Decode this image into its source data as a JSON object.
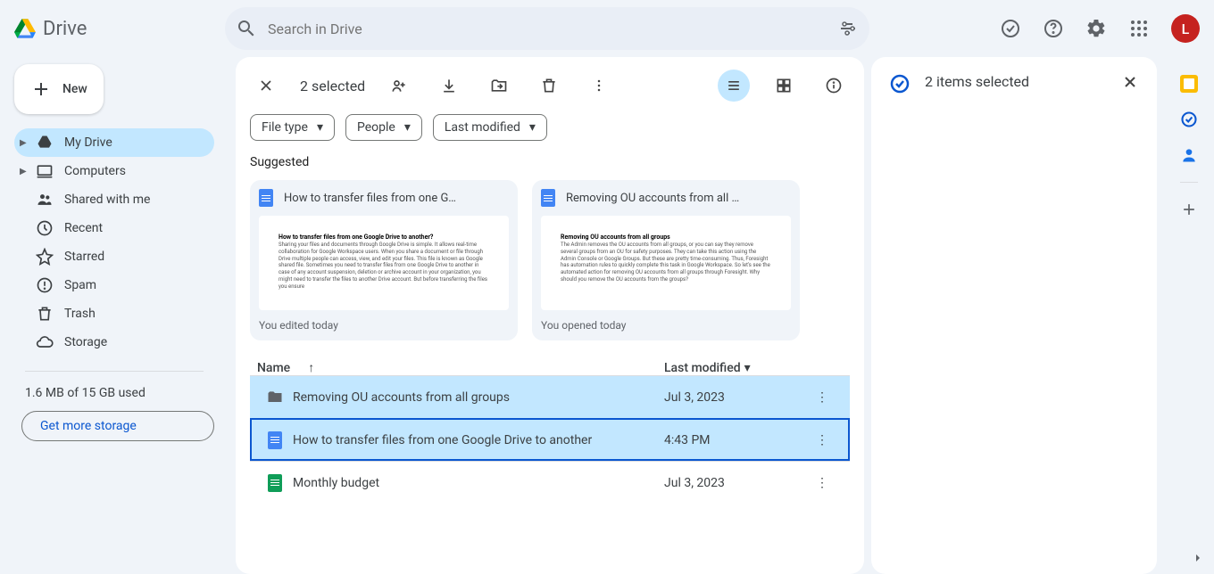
{
  "app": {
    "name": "Drive",
    "avatar_letter": "L"
  },
  "search": {
    "placeholder": "Search in Drive"
  },
  "sidebar": {
    "new_label": "New",
    "items": [
      {
        "label": "My Drive",
        "icon": "drive"
      },
      {
        "label": "Computers",
        "icon": "computer"
      },
      {
        "label": "Shared with me",
        "icon": "shared"
      },
      {
        "label": "Recent",
        "icon": "recent"
      },
      {
        "label": "Starred",
        "icon": "star"
      },
      {
        "label": "Spam",
        "icon": "spam"
      },
      {
        "label": "Trash",
        "icon": "trash"
      },
      {
        "label": "Storage",
        "icon": "storage"
      }
    ],
    "storage_used": "1.6 MB of 15 GB used",
    "storage_cta": "Get more storage"
  },
  "selection_bar": {
    "count_label": "2 selected"
  },
  "chips": {
    "file_type": "File type",
    "people": "People",
    "last_modified": "Last modified"
  },
  "suggested": {
    "title": "Suggested",
    "cards": [
      {
        "title": "How to transfer files from one G…",
        "meta": "You edited today",
        "thumb_title": "How to transfer files from one Google Drive to another?",
        "thumb_body": "Sharing your files and documents through Google Drive is simple. It allows real-time collaboration for Google Workspace users. When you share a document or file through Drive multiple people can access, view, and edit your files. This file is known as Google shared file. Sometimes you need to transfer files from one Google Drive to another in case of any account suspension, deletion or archive account in your organization, you might need to transfer the files to another Drive account. But before transferring the files you ensure"
      },
      {
        "title": "Removing OU accounts from all …",
        "meta": "You opened today",
        "thumb_title": "Removing OU accounts from all groups",
        "thumb_body": "The Admin removes the OU accounts from all groups, or you can say they remove several groups from an OU for safety purposes. They can take this action using the Admin Console or Google Groups. But these are pretty time-consuming. Thus, Foresight has automation rules to quickly complete this task in Google Workspace. So let's see the automated action for removing OU accounts from all groups through Foresight. Why should you remove the OU accounts from the groups?"
      }
    ]
  },
  "columns": {
    "name": "Name",
    "modified": "Last modified"
  },
  "files": [
    {
      "name": "Removing OU accounts from all groups",
      "modified": "Jul 3, 2023",
      "type": "folder"
    },
    {
      "name": "How to transfer files from one Google Drive to another",
      "modified": "4:43 PM",
      "type": "doc"
    },
    {
      "name": "Monthly budget",
      "modified": "Jul 3, 2023",
      "type": "sheet"
    }
  ],
  "details": {
    "title": "2 items selected"
  }
}
